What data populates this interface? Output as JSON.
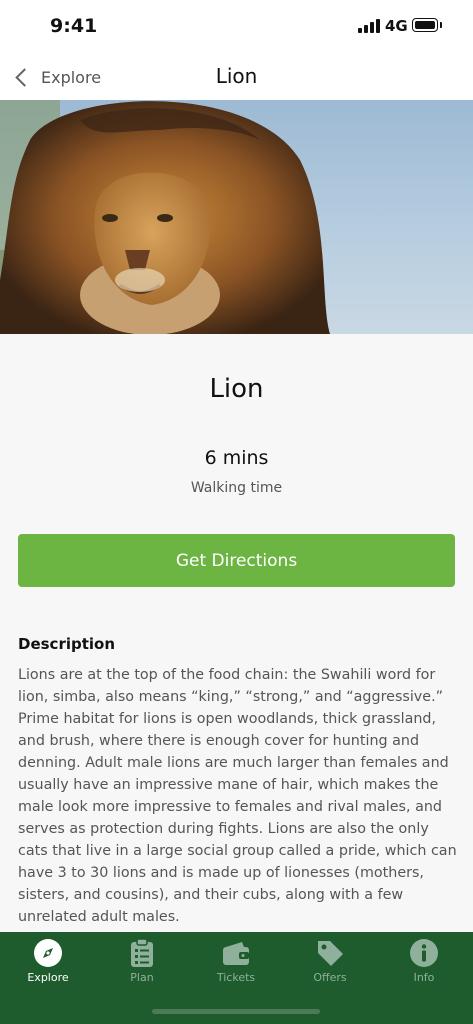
{
  "status_bar": {
    "time": "9:41",
    "network": "4G"
  },
  "nav": {
    "back_label": "Explore",
    "title": "Lion"
  },
  "hero": {
    "image_alt": "lion-photo"
  },
  "detail": {
    "title": "Lion",
    "walk_time": "6 mins",
    "walk_label": "Walking time",
    "directions_label": "Get Directions",
    "description_heading": "Description",
    "description": "Lions are at the top of the food chain: the Swahili word for lion, simba, also means “king,” “strong,” and “aggressive.” Prime habitat for lions is open woodlands, thick grassland, and brush, where there is enough cover for hunting and denning. Adult male lions are much larger than females and usually have an impressive mane of hair, which makes the male look more impressive to females and rival males, and serves as protection during fights. Lions are also the only cats that live in a large social group called a pride, which can have 3 to 30 lions and is made up of lionesses (mothers, sisters, and cousins), and their cubs, along with a few unrelated adult males."
  },
  "tabs": [
    {
      "label": "Explore",
      "icon": "compass-icon",
      "active": true
    },
    {
      "label": "Plan",
      "icon": "clipboard-list-icon",
      "active": false
    },
    {
      "label": "Tickets",
      "icon": "wallet-icon",
      "active": false
    },
    {
      "label": "Offers",
      "icon": "tag-icon",
      "active": false
    },
    {
      "label": "Info",
      "icon": "info-icon",
      "active": false
    }
  ],
  "colors": {
    "accent_green": "#6db543",
    "tab_bar": "#1e5b2d"
  }
}
